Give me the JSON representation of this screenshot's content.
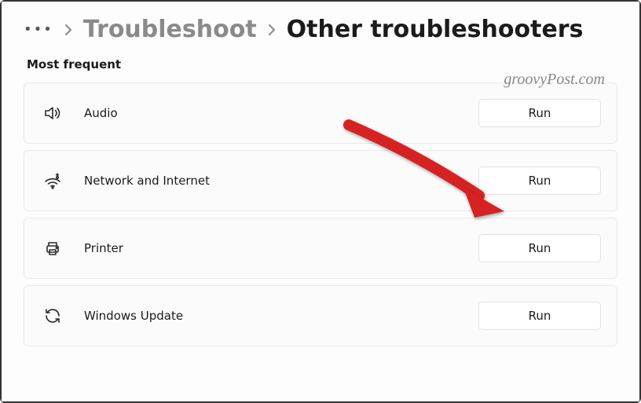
{
  "breadcrumb": {
    "link": "Troubleshoot",
    "current": "Other troubleshooters"
  },
  "section_title": "Most frequent",
  "watermark": "groovyPost.com",
  "run_label": "Run",
  "items": [
    {
      "label": "Audio"
    },
    {
      "label": "Network and Internet"
    },
    {
      "label": "Printer"
    },
    {
      "label": "Windows Update"
    }
  ]
}
